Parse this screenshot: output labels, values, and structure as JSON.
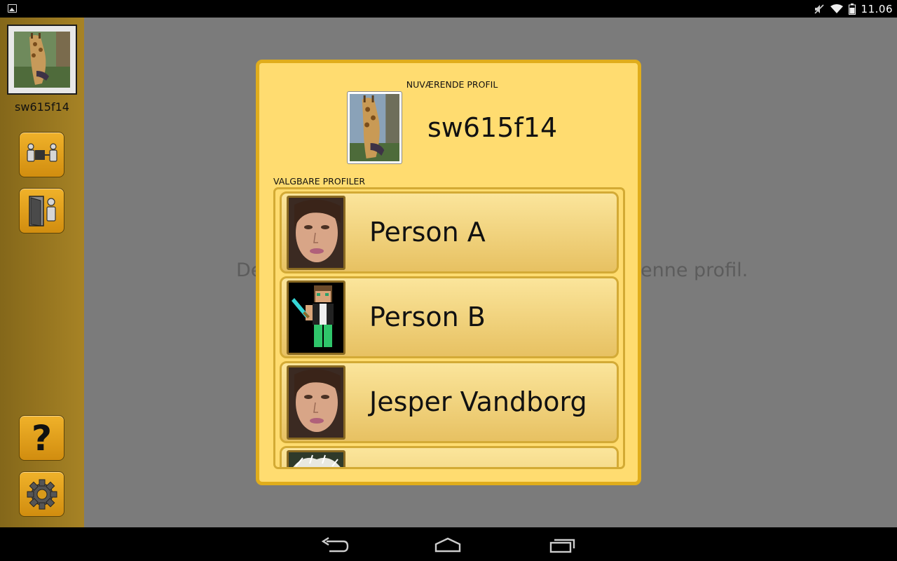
{
  "status_bar": {
    "time": "11.06",
    "icons": [
      "gallery-icon",
      "mute-icon",
      "wifi-icon",
      "battery-icon"
    ]
  },
  "sidebar": {
    "username": "sw615f14",
    "avatar": "giraffe-photo",
    "buttons": [
      {
        "name": "switch-profile-button",
        "icon": "person-transfer-icon"
      },
      {
        "name": "logout-button",
        "icon": "door-exit-icon"
      },
      {
        "name": "help-button",
        "icon": "question-mark-icon",
        "glyph": "?"
      },
      {
        "name": "settings-button",
        "icon": "gear-icon"
      }
    ]
  },
  "background": {
    "text_left": "De",
    "text_right": "enne profil."
  },
  "dialog": {
    "current_label": "NUVÆRENDE PROFIL",
    "current_name": "sw615f14",
    "current_avatar": "giraffe-photo",
    "choose_label": "VALGBARE PROFILER",
    "profiles": [
      {
        "name": "Person A",
        "avatar": "woman-face-photo"
      },
      {
        "name": "Person B",
        "avatar": "minecraft-character-image"
      },
      {
        "name": "Jesper Vandborg",
        "avatar": "woman-face-photo"
      },
      {
        "name": "",
        "avatar": "bird-photo"
      }
    ]
  },
  "nav_bar": {
    "buttons": [
      "back-icon",
      "home-icon",
      "recent-apps-icon"
    ]
  },
  "colors": {
    "sidebar": "#b08a27",
    "dialog_bg": "#ffdc70",
    "dialog_border": "#e0ad1c",
    "button_gold": "#e5a01c"
  }
}
